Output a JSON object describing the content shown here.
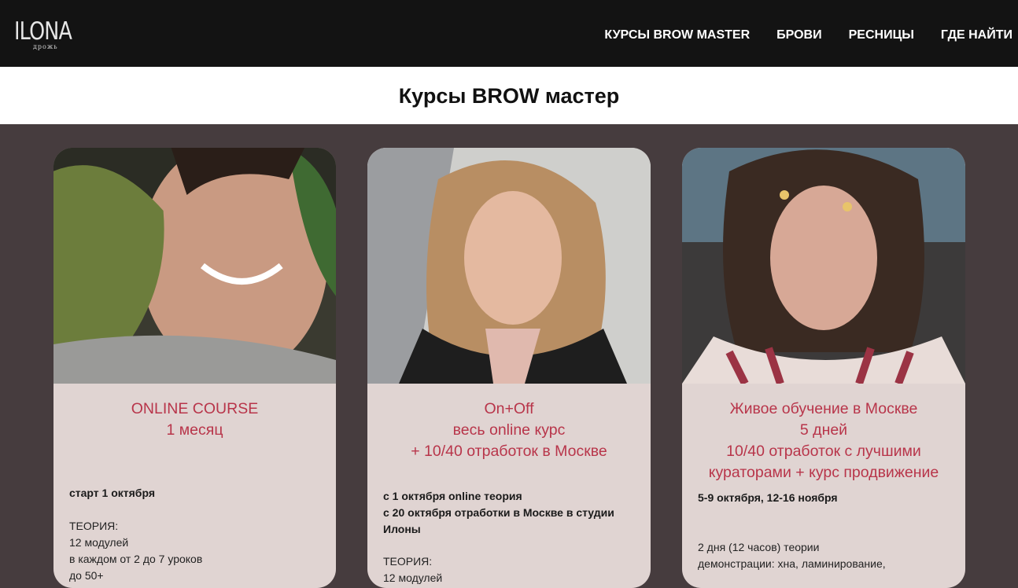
{
  "header": {
    "logo": {
      "word": "ILONA",
      "sub": "дрожь"
    },
    "nav": [
      "КУРСЫ BROW MASTER",
      "БРОВИ",
      "РЕСНИЦЫ",
      "ГДЕ НАЙТИ"
    ]
  },
  "page_title": "Курсы BROW мастер",
  "colors": {
    "accent": "#b8354a",
    "card_bg": "#e0d4d2",
    "page_bg": "#463c3e",
    "header_bg": "#131313"
  },
  "cards": [
    {
      "photo_icon": "portrait-photo",
      "heading": [
        "ONLINE COURSE",
        "1 месяц"
      ],
      "bold_lines": [
        "старт 1 октября"
      ],
      "plain_lines": [
        "ТЕОРИЯ:",
        "12 модулей",
        "в каждом от 2 до 7 уроков",
        "до 50+"
      ]
    },
    {
      "photo_icon": "portrait-photo",
      "heading": [
        "On+Off",
        "весь online курс",
        "+ 10/40 отработок в Москве"
      ],
      "bold_lines": [
        "с 1 октября online теория",
        "с 20 октября отработки в Москве в студии",
        "Илоны"
      ],
      "plain_lines": [
        "ТЕОРИЯ:",
        "12 модулей"
      ]
    },
    {
      "photo_icon": "portrait-photo",
      "heading": [
        "Живое обучение в Москве",
        "5 дней",
        "10/40 отработок с лучшими",
        "кураторами + курс продвижение"
      ],
      "bold_lines": [
        "5-9 октября, 12-16 ноября"
      ],
      "plain_lines": [
        "2 дня (12 часов) теории",
        "демонстрации: хна, ламинирование,"
      ]
    }
  ]
}
